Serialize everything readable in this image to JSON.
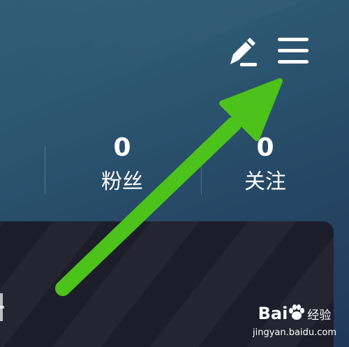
{
  "header": {
    "edit_icon": "pencil-icon",
    "menu_icon": "hamburger-menu-icon"
  },
  "stats": {
    "followers": {
      "value": "0",
      "label": "粉丝"
    },
    "following": {
      "value": "0",
      "label": "关注"
    }
  },
  "annotation": {
    "arrow_color": "#4cc21a",
    "arrow_target": "menu-button"
  },
  "watermark": {
    "brand": "Bai",
    "brand_suffix": "经验",
    "url": "jingyan.baidu.com"
  },
  "colors": {
    "background_top": "#2f5f75",
    "background_bottom": "#20385a",
    "card": "#1d1d2a",
    "text": "#ffffff"
  }
}
